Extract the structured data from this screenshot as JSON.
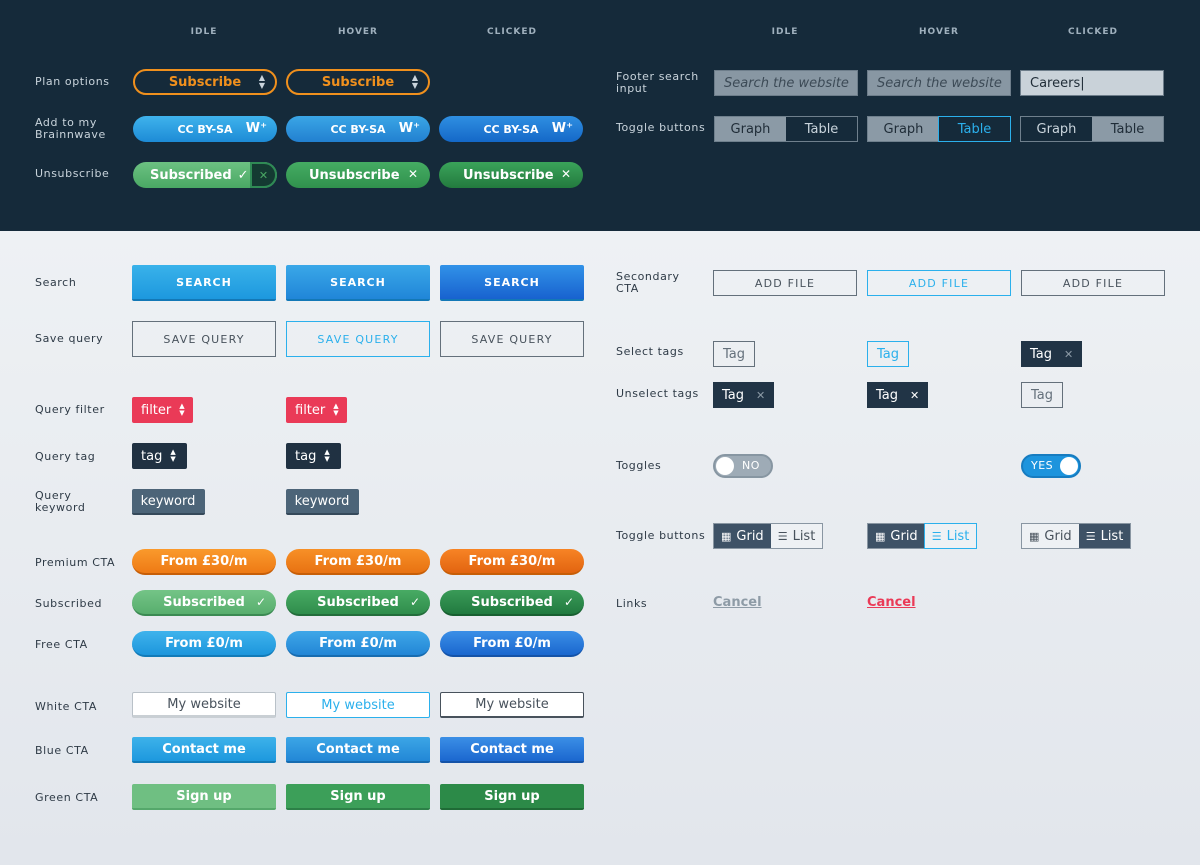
{
  "columns": [
    "IDLE",
    "HOVER",
    "CLICKED"
  ],
  "top": {
    "labels": {
      "plan_options": "Plan options",
      "add_to_brainwave": "Add to my Brainnwave",
      "unsubscribe": "Unsubscribe",
      "footer_search": "Footer search input",
      "toggle_buttons": "Toggle buttons"
    },
    "plan_label": "Subscribe",
    "cc_label": "CC BY-SA",
    "unsubscribe_idle": "Subscribed",
    "unsubscribe_active": "Unsubscribe",
    "search_placeholder": "Search the website",
    "search_value": "Careers",
    "toggle_graph": "Graph",
    "toggle_table": "Table"
  },
  "bottom": {
    "labels": {
      "search": "Search",
      "save_query": "Save query",
      "query_filter": "Query filter",
      "query_tag": "Query tag",
      "query_keyword": "Query keyword",
      "premium_cta": "Premium CTA",
      "subscribed": "Subscribed",
      "free_cta": "Free CTA",
      "white_cta": "White CTA",
      "blue_cta": "Blue CTA",
      "green_cta": "Green CTA",
      "secondary_cta": "Secondary CTA",
      "select_tags": "Select tags",
      "unselect_tags": "Unselect tags",
      "toggles": "Toggles",
      "toggle_buttons": "Toggle buttons",
      "links": "Links"
    },
    "search_label": "SEARCH",
    "save_query_label": "SAVE QUERY",
    "filter_label": "filter",
    "tag_label": "tag",
    "keyword_label": "keyword",
    "premium_label": "From £30/m",
    "subscribed_label": "Subscribed",
    "free_label": "From £0/m",
    "white_label": "My website",
    "blue_label": "Contact me",
    "green_label": "Sign up",
    "add_file_label": "ADD FILE",
    "tag_chip_label": "Tag",
    "toggle_no": "NO",
    "toggle_yes": "YES",
    "grid_label": "Grid",
    "list_label": "List",
    "cancel_label": "Cancel"
  },
  "colors": {
    "top_bg": "#152a3a",
    "orange": "#f0901d",
    "blue": "#2bb0ec",
    "green": "#3c9f59",
    "red": "#ea3a57"
  }
}
